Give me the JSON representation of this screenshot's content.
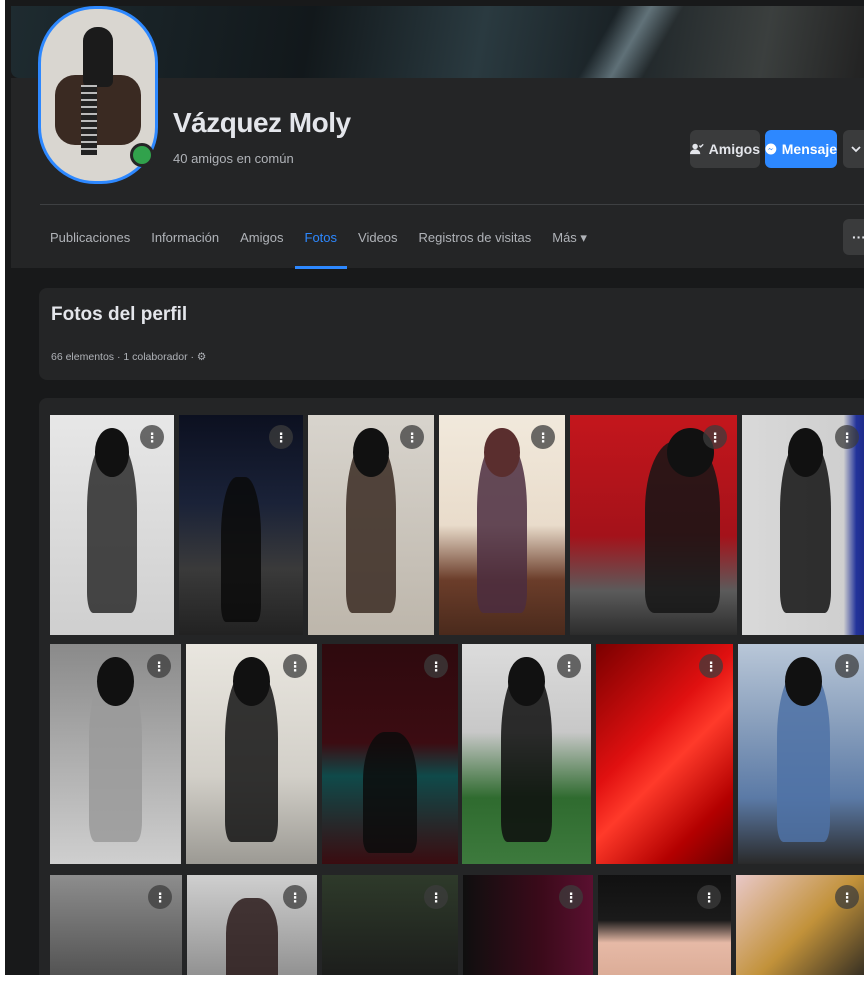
{
  "profile": {
    "name": "Vázquez Moly",
    "mutual_friends": "40 amigos en común"
  },
  "actions": {
    "friends_label": "Amigos",
    "message_label": "Mensaje",
    "more_icon": "chevron-down-icon"
  },
  "tabs": [
    {
      "label": "Publicaciones"
    },
    {
      "label": "Información"
    },
    {
      "label": "Amigos"
    },
    {
      "label": "Fotos",
      "active": true
    },
    {
      "label": "Videos"
    },
    {
      "label": "Registros de visitas"
    },
    {
      "label": "Más ▾"
    }
  ],
  "tabs_more_button": "···",
  "album": {
    "title": "Fotos del perfil",
    "meta": "66 elementos · 1 colaborador · ⚙"
  },
  "photo_menu_glyph": "⋮",
  "colors": {
    "accent": "#2d88ff",
    "background": "#18191a",
    "card": "#242526",
    "online": "#31a24c"
  }
}
